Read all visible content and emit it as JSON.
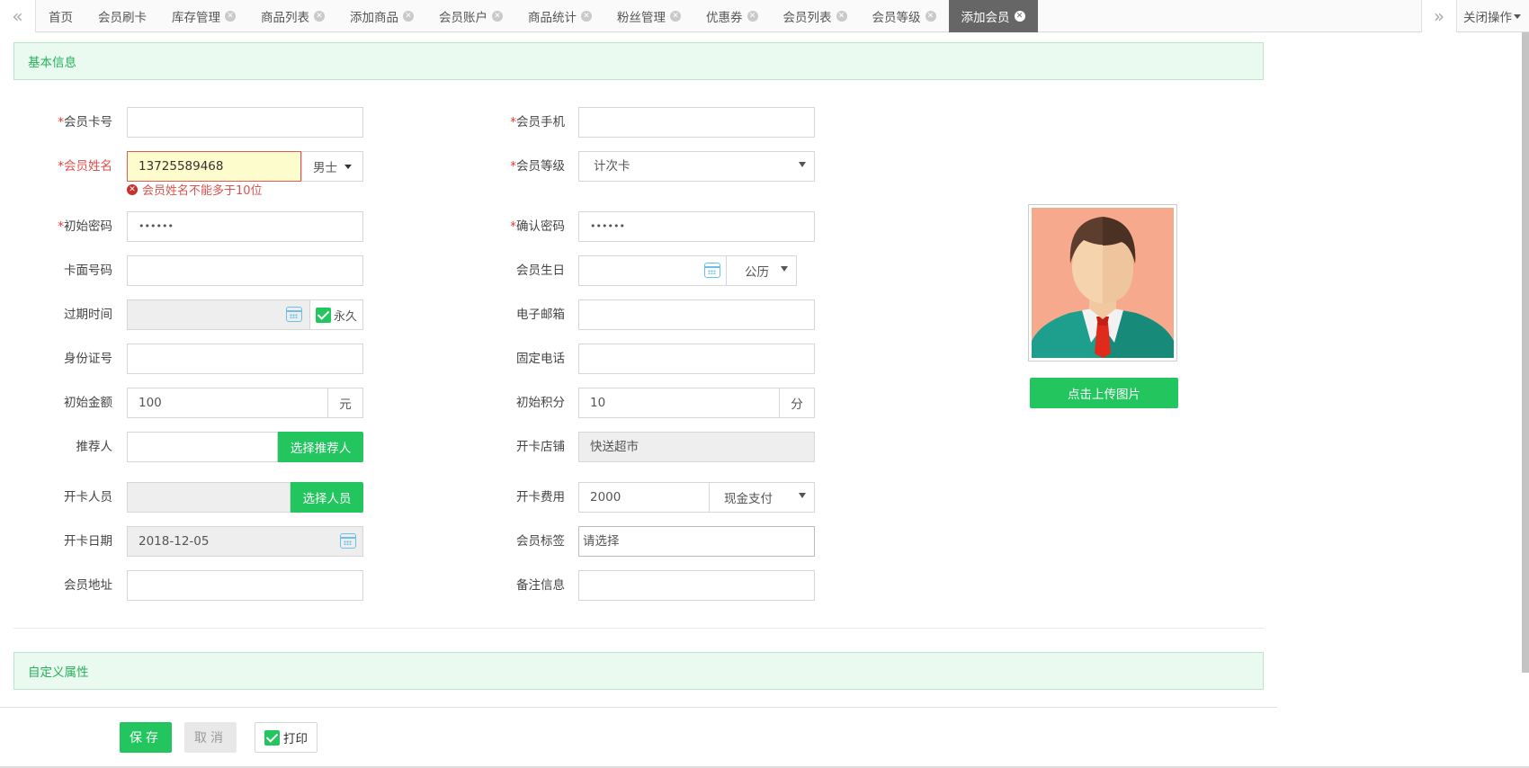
{
  "tabbar": {
    "tabs": [
      {
        "label": "首页",
        "closable": false,
        "active": false
      },
      {
        "label": "会员刷卡",
        "closable": false,
        "active": false
      },
      {
        "label": "库存管理",
        "closable": true,
        "active": false
      },
      {
        "label": "商品列表",
        "closable": true,
        "active": false
      },
      {
        "label": "添加商品",
        "closable": true,
        "active": false
      },
      {
        "label": "会员账户",
        "closable": true,
        "active": false
      },
      {
        "label": "商品统计",
        "closable": true,
        "active": false
      },
      {
        "label": "粉丝管理",
        "closable": true,
        "active": false
      },
      {
        "label": "优惠券",
        "closable": true,
        "active": false
      },
      {
        "label": "会员列表",
        "closable": true,
        "active": false
      },
      {
        "label": "会员等级",
        "closable": true,
        "active": false
      },
      {
        "label": "添加会员",
        "closable": true,
        "active": true
      }
    ],
    "close_ops": "关闭操作"
  },
  "sections": {
    "basic": "基本信息",
    "custom": "自定义属性"
  },
  "form": {
    "card_no": {
      "label": "会员卡号",
      "required": true,
      "value": ""
    },
    "mobile": {
      "label": "会员手机",
      "required": true,
      "value": ""
    },
    "name": {
      "label": "会员姓名",
      "required": true,
      "value": "13725589468",
      "error": "会员姓名不能多于10位",
      "gender": "男士"
    },
    "level": {
      "label": "会员等级",
      "required": true,
      "value": "计次卡"
    },
    "password": {
      "label": "初始密码",
      "required": true,
      "value": "••••••"
    },
    "confirm_password": {
      "label": "确认密码",
      "required": true,
      "value": "••••••"
    },
    "card_face_no": {
      "label": "卡面号码",
      "value": ""
    },
    "birthday": {
      "label": "会员生日",
      "value": "",
      "calendar": "公历"
    },
    "expire": {
      "label": "过期时间",
      "value": "",
      "forever": "永久"
    },
    "email": {
      "label": "电子邮箱",
      "value": ""
    },
    "id_card": {
      "label": "身份证号",
      "value": ""
    },
    "phone": {
      "label": "固定电话",
      "value": ""
    },
    "amount": {
      "label": "初始金额",
      "value": "100",
      "unit": "元"
    },
    "points": {
      "label": "初始积分",
      "value": "10",
      "unit": "分"
    },
    "referrer": {
      "label": "推荐人",
      "value": "",
      "button": "选择推荐人"
    },
    "store": {
      "label": "开卡店铺",
      "value": "快送超市"
    },
    "staff": {
      "label": "开卡人员",
      "value": "",
      "button": "选择人员"
    },
    "fee": {
      "label": "开卡费用",
      "value": "2000",
      "payment": "现金支付"
    },
    "open_date": {
      "label": "开卡日期",
      "value": "2018-12-05"
    },
    "tags": {
      "label": "会员标签",
      "placeholder": "请选择"
    },
    "address": {
      "label": "会员地址",
      "value": ""
    },
    "remark": {
      "label": "备注信息",
      "value": ""
    }
  },
  "avatar": {
    "upload_label": "点击上传图片"
  },
  "footer": {
    "save": "保存",
    "cancel": "取消",
    "print": "打印"
  },
  "colors": {
    "accent": "#22c55e",
    "error": "#d9534f",
    "section_bg": "#eafaf0"
  }
}
